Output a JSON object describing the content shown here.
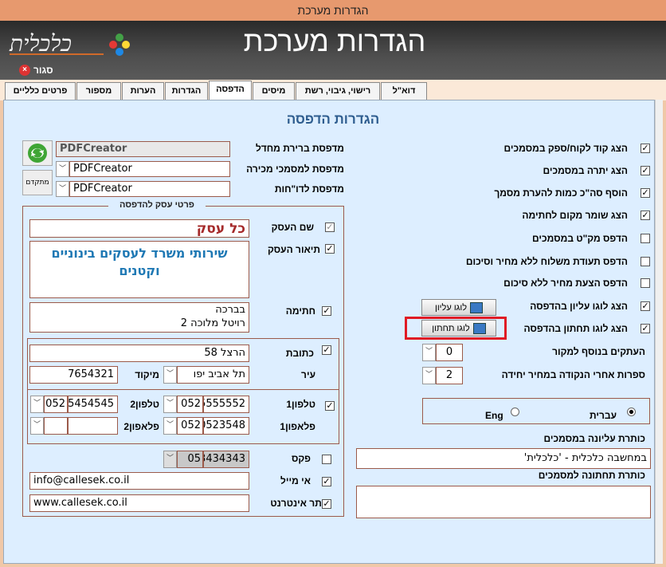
{
  "window_title": "הגדרות מערכת",
  "header": {
    "title": "הגדרות מערכת",
    "logo_text": "כלכלית",
    "close_label": "סגור"
  },
  "tabs": [
    "דוא\"ל",
    "רישוי, גיבוי, רשת",
    "מיסים",
    "הדפסה",
    "הגדרות",
    "הערות",
    "מספור",
    "פרטים כלליים"
  ],
  "section_title": "הגדרות הדפסה",
  "options": [
    {
      "label": "הצג קוד לקוח/ספק במסמכים",
      "checked": true
    },
    {
      "label": "הצג יתרה במסמכים",
      "checked": true
    },
    {
      "label": "הוסף סה\"כ כמות להערת מסמך",
      "checked": true
    },
    {
      "label": "הצג שומר מקום לחתימה",
      "checked": true
    },
    {
      "label": "הדפס מק\"ט במסמכים",
      "checked": false
    },
    {
      "label": "הדפס תעודת משלוח ללא מחיר וסיכום",
      "checked": false
    },
    {
      "label": "הדפס הצעת מחיר ללא סיכום",
      "checked": false
    },
    {
      "label": "הצג לוגו עליון בהדפסה",
      "checked": true
    },
    {
      "label": "הצג לוגו תחתון בהדפסה",
      "checked": true
    }
  ],
  "logo_buttons": {
    "top": "לוגו עליון",
    "bottom": "לוגו תחתון"
  },
  "copies": {
    "label": "העתקים בנוסף למקור",
    "value": "0"
  },
  "decimals": {
    "label": "ספרות אחרי הנקודה במחיר יחידה",
    "value": "2"
  },
  "language": {
    "hebrew": "עברית",
    "english": "Eng",
    "selected": "hebrew"
  },
  "top_caption": {
    "label": "כותרת עליונה במסמכים",
    "value": "במחשבה כלכלית - 'כלכלית'"
  },
  "bottom_caption": {
    "label": "כותרת תחתונה למסמכים",
    "value": ""
  },
  "printers": {
    "default_label": "מדפסת ברירת מחדל",
    "default_value": "PDFCreator",
    "sales_label": "מדפסת למסמכי מכירה",
    "sales_value": "PDFCreator",
    "reports_label": "מדפסת לדו\"חות",
    "reports_value": "PDFCreator",
    "advanced_button": "מתקדם"
  },
  "business": {
    "group_title": "פרטי עסק להדפסה",
    "name_label": "שם העסק",
    "name_value": "כל עסק",
    "desc_label": "תיאור העסק",
    "desc_value": "שירותי משרד לעסקים בינוניים וקטנים",
    "signature_label": "חתימה",
    "signature_line1": "בברכה",
    "signature_line2": "רויטל מלוכה 2",
    "address_label": "כתובת",
    "address_value": "הרצל 58",
    "city_label": "עיר",
    "city_value": "תל אביב יפו",
    "zip_label": "מיקוד",
    "zip_value": "7654321",
    "phone1_label": "טלפון1",
    "phone1_num": "5555552",
    "phone1_prefix": "052",
    "phone2_label": "טלפון2",
    "phone2_num": "5454545",
    "phone2_prefix": "052",
    "mobile1_label": "פלאפון1",
    "mobile1_num": "0523548",
    "mobile1_prefix": "052",
    "mobile2_label": "פלאפון2",
    "mobile2_num": "",
    "mobile2_prefix": "",
    "fax_label": "פקס",
    "fax_num": "3434343",
    "fax_prefix": "05",
    "email_label": "אי מייל",
    "email_value": "info@callesek.co.il",
    "website_label": "אתר אינטרנט",
    "website_value": "www.callesek.co.il"
  },
  "colors": {
    "highlight": "#e01b24",
    "accent": "#2e5d8f",
    "name_red": "#a52a2a",
    "desc_blue": "#1e78b4"
  }
}
